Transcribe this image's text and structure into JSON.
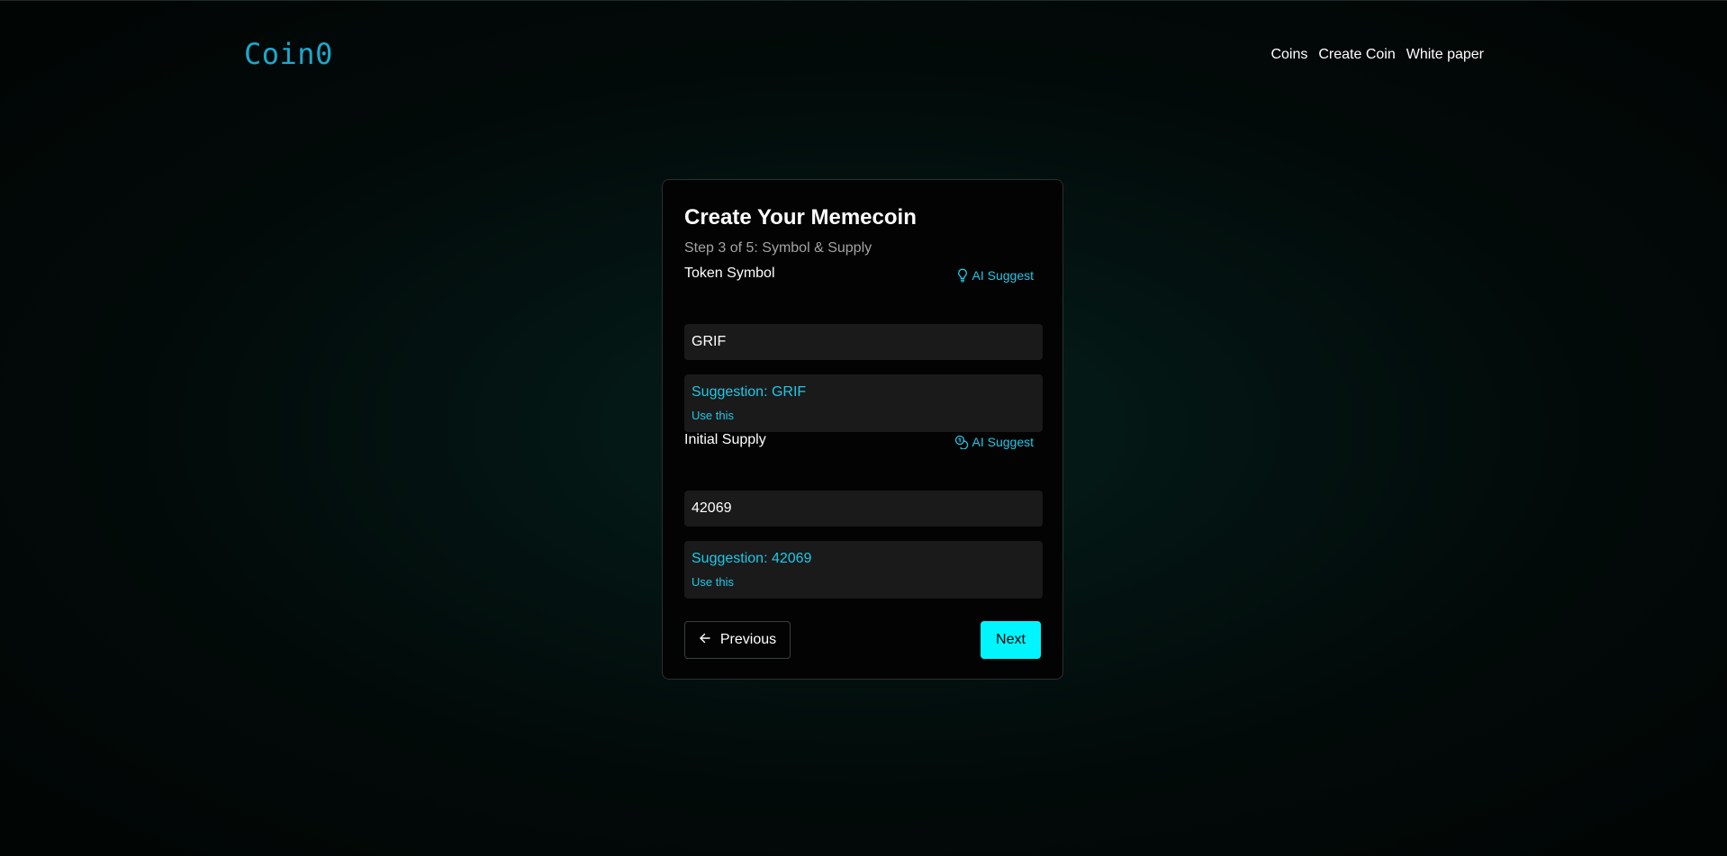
{
  "header": {
    "logo": "Coin0",
    "nav": [
      "Coins",
      "Create Coin",
      "White paper"
    ]
  },
  "card": {
    "title": "Create Your Memecoin",
    "subtitle": "Step 3 of 5: Symbol & Supply"
  },
  "token_symbol": {
    "label": "Token Symbol",
    "ai_suggest": "AI Suggest",
    "ai_suggest_icon": "lightbulb-icon",
    "value": "GRIF",
    "suggestion": "Suggestion: GRIF",
    "use_this": "Use this"
  },
  "initial_supply": {
    "label": "Initial Supply",
    "ai_suggest": "AI Suggest",
    "ai_suggest_icon": "coins-icon",
    "value": "42069",
    "suggestion": "Suggestion: 42069",
    "use_this": "Use this"
  },
  "buttons": {
    "previous": "Previous",
    "next": "Next"
  },
  "colors": {
    "accent": "#1ec8e8",
    "next_button": "#00f5ff",
    "logo": "#1ba8cc",
    "input_bg": "#1a1a1a"
  }
}
